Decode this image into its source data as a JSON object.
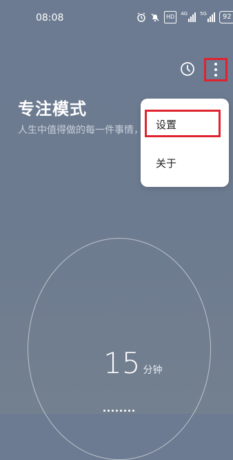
{
  "status_bar": {
    "time": "08:08",
    "hd_label": "HD",
    "sim1_label": "4G",
    "sim2_label": "5G",
    "battery": "92"
  },
  "toolbar": {
    "history_icon": "clock-icon",
    "more_icon": "more-vertical-icon"
  },
  "page": {
    "title": "专注模式",
    "subtitle": "人生中值得做的每一件事情，都需"
  },
  "menu": {
    "items": [
      {
        "label": "设置"
      },
      {
        "label": "关于"
      }
    ]
  },
  "timer": {
    "value": "15",
    "unit": "分钟"
  },
  "colors": {
    "highlight": "#e0222e",
    "background": "#6c7b91"
  }
}
